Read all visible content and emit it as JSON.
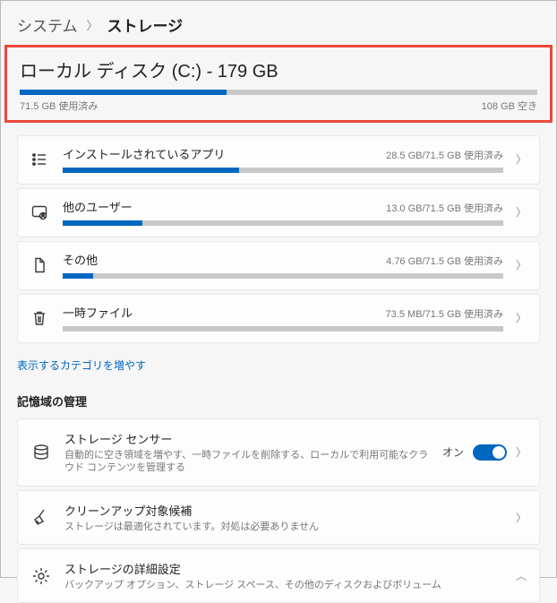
{
  "breadcrumb": {
    "parent": "システム",
    "current": "ストレージ"
  },
  "disk": {
    "title": "ローカル ディスク (C:) - 179 GB",
    "used_label": "71.5 GB 使用済み",
    "free_label": "108 GB 空き",
    "used_gb": 71.5,
    "total_gb": 179,
    "fill_pct": 40
  },
  "categories": [
    {
      "id": "apps",
      "label": "インストールされているアプリ",
      "usage": "28.5 GB/71.5 GB 使用済み",
      "fill_pct": 40
    },
    {
      "id": "users",
      "label": "他のユーザー",
      "usage": "13.0 GB/71.5 GB 使用済み",
      "fill_pct": 18
    },
    {
      "id": "other",
      "label": "その他",
      "usage": "4.76 GB/71.5 GB 使用済み",
      "fill_pct": 7
    },
    {
      "id": "temp",
      "label": "一時ファイル",
      "usage": "73.5 MB/71.5 GB 使用済み",
      "fill_pct": 0
    }
  ],
  "more_link": "表示するカテゴリを増やす",
  "mgmt_header": "記憶域の管理",
  "mgmt": [
    {
      "id": "sense",
      "title": "ストレージ センサー",
      "desc": "自動的に空き領域を増やす、一時ファイルを削除する、ローカルで利用可能なクラウド コンテンツを管理する",
      "toggle": true,
      "state_label": "オン",
      "chevron": "right"
    },
    {
      "id": "cleanup",
      "title": "クリーンアップ対象候補",
      "desc": "ストレージは最適化されています。対処は必要ありません",
      "toggle": false,
      "chevron": "right"
    },
    {
      "id": "advanced",
      "title": "ストレージの詳細設定",
      "desc": "バックアップ オプション、ストレージ スペース、その他のディスクおよびボリューム",
      "toggle": false,
      "chevron": "down"
    }
  ]
}
